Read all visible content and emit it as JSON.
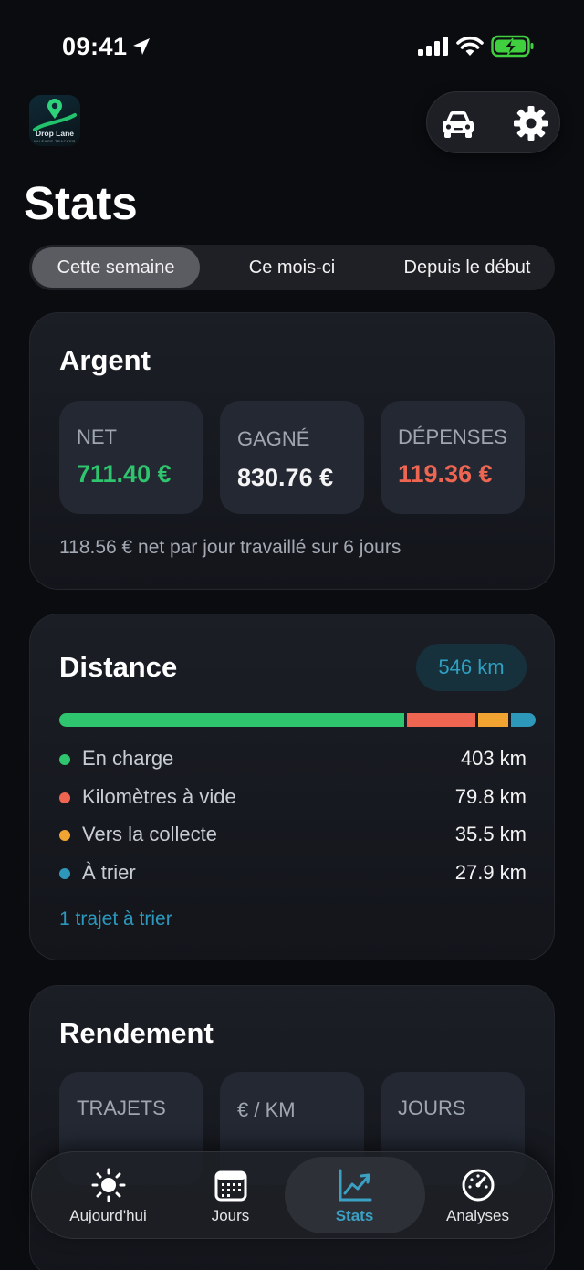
{
  "status_bar": {
    "time": "09:41"
  },
  "app": {
    "logo_name": "Drop Lane",
    "logo_sub": "MILEAGE TRACKER"
  },
  "header": {
    "title": "Stats",
    "car_icon": "car-icon",
    "settings_icon": "gear-icon"
  },
  "period_tabs": [
    "Cette semaine",
    "Ce mois-ci",
    "Depuis le début"
  ],
  "period_selected": "Cette semaine",
  "money": {
    "title": "Argent",
    "net_label": "NET",
    "net_value": "711.40 €",
    "earned_label": "GAGNÉ",
    "earned_value": "830.76 €",
    "expenses_label": "DÉPENSES",
    "expenses_value": "119.36 €",
    "footnote": "118.56 € net par jour travaillé sur 6 jours"
  },
  "distance": {
    "title": "Distance",
    "total": "546 km",
    "rows": [
      {
        "label": "En charge",
        "value": "403 km",
        "color": "#2ec56e"
      },
      {
        "label": "Kilomètres à vide",
        "value": "79.8 km",
        "color": "#ee6652"
      },
      {
        "label": "Vers la collecte",
        "value": "35.5 km",
        "color": "#f2a432"
      },
      {
        "label": "À trier",
        "value": "27.9 km",
        "color": "#2d98ba"
      }
    ],
    "link": "1 trajet à trier"
  },
  "performance": {
    "title": "Rendement",
    "trips_label": "TRAJETS",
    "per_km_label": "€ / KM",
    "days_label": "JOURS"
  },
  "tabbar": {
    "items": [
      {
        "label": "Aujourd'hui",
        "icon": "sun-icon"
      },
      {
        "label": "Jours",
        "icon": "calendar-icon"
      },
      {
        "label": "Stats",
        "icon": "chart-icon"
      },
      {
        "label": "Analyses",
        "icon": "gauge-icon"
      }
    ],
    "active": "Stats"
  },
  "colors": {
    "positive": "#2ec56e",
    "negative": "#ee6652",
    "accent": "#2c98bd"
  }
}
